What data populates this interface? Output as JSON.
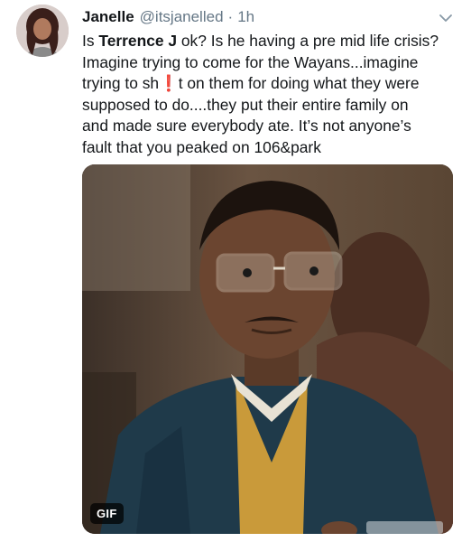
{
  "tweet": {
    "display_name": "Janelle",
    "handle": "@itsjanelled",
    "separator": "·",
    "timestamp": "1h",
    "text_lines": [
      {
        "pre": "Is ",
        "bold": "Terrence J",
        "post": " ok? Is he having a pre mid life crisis?"
      },
      {
        "text": "Imagine trying to come for the Wayans...imagine"
      },
      {
        "pre": "trying to sh",
        "emoji": "❗",
        "post": "t on them for doing what they were"
      },
      {
        "text": "supposed to do....they put their entire family on"
      },
      {
        "text": "and made sure everybody ate. It’s not anyone’s"
      },
      {
        "text": "fault that you peaked on 106&park"
      }
    ],
    "media_badge": "GIF",
    "icons": {
      "avatar": "avatar-photo",
      "menu": "chevron-down-icon",
      "emoji": "exclamation-emoji"
    },
    "colors": {
      "text": "#14171a",
      "secondary": "#657786",
      "emoji": "#e0245e"
    }
  }
}
